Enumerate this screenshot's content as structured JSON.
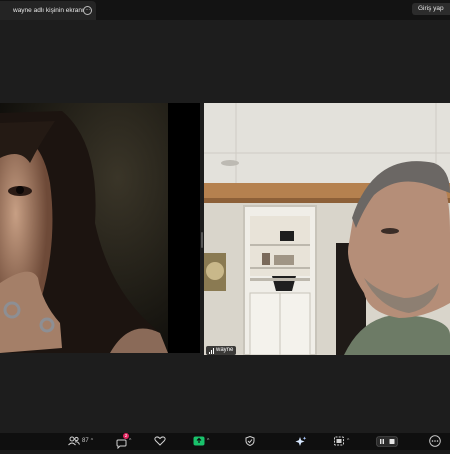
{
  "window": {
    "tab_title": "wayne adlı kişinin ekranı",
    "tab_menu_glyph": "···",
    "login_button": "Giriş yap"
  },
  "participants": [
    {
      "name": "",
      "video": "woman-portrait"
    },
    {
      "name": "wayne",
      "video": "man-room"
    }
  ],
  "toolbar": {
    "participants_count": "87",
    "chat_badge": "2",
    "icons": [
      "participants-icon",
      "chat-icon",
      "reactions-icon",
      "share-screen-icon",
      "shield-icon",
      "ai-companion-icon",
      "view-icon",
      "pause-stop-icon",
      "more-icon"
    ]
  },
  "colors": {
    "share_green": "#19c26b",
    "badge_red": "#e0245e",
    "background": "#1d1d1d"
  }
}
